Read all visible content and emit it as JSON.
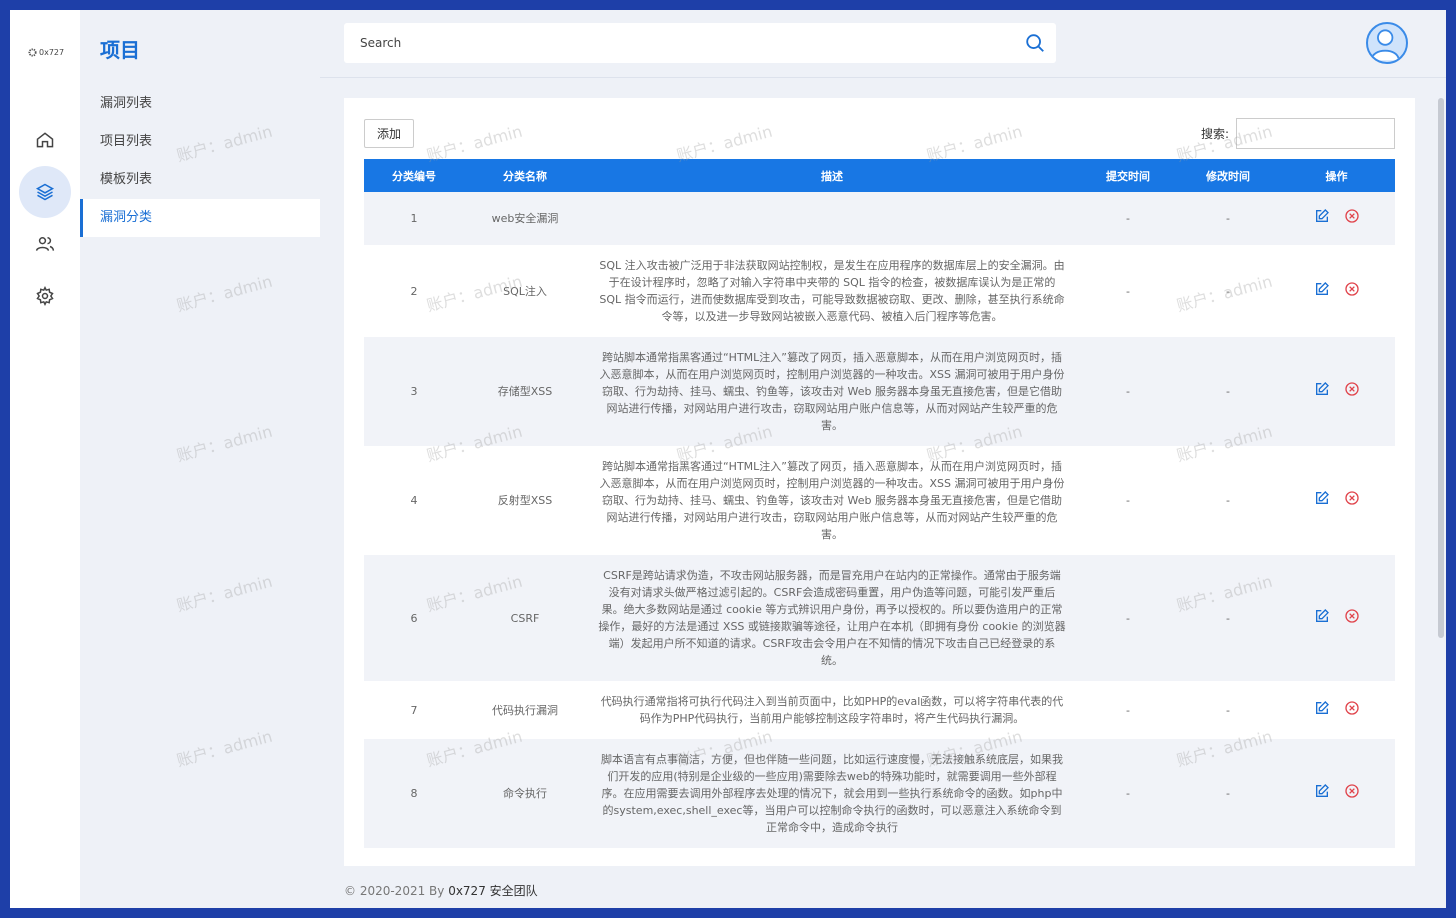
{
  "brand": {
    "logo_text": "0x727"
  },
  "nav_rail": {
    "items": [
      {
        "icon": "home-icon"
      },
      {
        "icon": "layers-icon",
        "active": true
      },
      {
        "icon": "users-icon"
      },
      {
        "icon": "gear-icon"
      }
    ]
  },
  "sidebar": {
    "title": "项目",
    "items": [
      {
        "label": "漏洞列表"
      },
      {
        "label": "项目列表"
      },
      {
        "label": "模板列表"
      },
      {
        "label": "漏洞分类",
        "active": true
      }
    ]
  },
  "search": {
    "placeholder": "Search"
  },
  "toolbar": {
    "add_label": "添加",
    "filter_label": "搜索:"
  },
  "watermark": "账户：admin",
  "table": {
    "headers": [
      "分类编号",
      "分类名称",
      "描述",
      "提交时间",
      "修改时间",
      "操作"
    ],
    "rows": [
      {
        "id": "1",
        "name": "web安全漏洞",
        "desc": "",
        "submitted": "-",
        "modified": "-"
      },
      {
        "id": "2",
        "name": "SQL注入",
        "desc": "SQL 注入攻击被广泛用于非法获取网站控制权，是发生在应用程序的数据库层上的安全漏洞。由于在设计程序时，忽略了对输入字符串中夹带的 SQL 指令的检查，被数据库误认为是正常的 SQL 指令而运行，进而使数据库受到攻击，可能导致数据被窃取、更改、删除，甚至执行系统命令等，以及进一步导致网站被嵌入恶意代码、被植入后门程序等危害。",
        "submitted": "-",
        "modified": "-"
      },
      {
        "id": "3",
        "name": "存储型XSS",
        "desc": "跨站脚本通常指黑客通过“HTML注入”篡改了网页，插入恶意脚本，从而在用户浏览网页时，插入恶意脚本，从而在用户浏览网页时，控制用户浏览器的一种攻击。XSS 漏洞可被用于用户身份窃取、行为劫持、挂马、蠕虫、钓鱼等，该攻击对 Web 服务器本身虽无直接危害，但是它借助网站进行传播，对网站用户进行攻击，窃取网站用户账户信息等，从而对网站产生较严重的危害。",
        "submitted": "-",
        "modified": "-"
      },
      {
        "id": "4",
        "name": "反射型XSS",
        "desc": "跨站脚本通常指黑客通过“HTML注入”篡改了网页，插入恶意脚本，从而在用户浏览网页时，插入恶意脚本，从而在用户浏览网页时，控制用户浏览器的一种攻击。XSS 漏洞可被用于用户身份窃取、行为劫持、挂马、蠕虫、钓鱼等，该攻击对 Web 服务器本身虽无直接危害，但是它借助网站进行传播，对网站用户进行攻击，窃取网站用户账户信息等，从而对网站产生较严重的危害。",
        "submitted": "-",
        "modified": "-"
      },
      {
        "id": "6",
        "name": "CSRF",
        "desc": "CSRF是跨站请求伪造，不攻击网站服务器，而是冒充用户在站内的正常操作。通常由于服务端没有对请求头做严格过滤引起的。CSRF会造成密码重置，用户伪造等问题，可能引发严重后果。绝大多数网站是通过 cookie 等方式辨识用户身份，再予以授权的。所以要伪造用户的正常操作，最好的方法是通过 XSS 或链接欺骗等途径，让用户在本机（即拥有身份 cookie 的浏览器端）发起用户所不知道的请求。CSRF攻击会令用户在不知情的情况下攻击自己已经登录的系统。",
        "submitted": "-",
        "modified": "-"
      },
      {
        "id": "7",
        "name": "代码执行漏洞",
        "desc": "代码执行通常指将可执行代码注入到当前页面中，比如PHP的eval函数，可以将字符串代表的代码作为PHP代码执行，当前用户能够控制这段字符串时，将产生代码执行漏洞。",
        "submitted": "-",
        "modified": "-"
      },
      {
        "id": "8",
        "name": "命令执行",
        "desc": "脚本语言有点事简洁，方便，但也伴随一些问题，比如运行速度慢，无法接触系统底层，如果我们开发的应用(特别是企业级的一些应用)需要除去web的特殊功能时，就需要调用一些外部程序。在应用需要去调用外部程序去处理的情况下，就会用到一些执行系统命令的函数。如php中的system,exec,shell_exec等，当用户可以控制命令执行的函数时，可以恶意注入系统命令到正常命令中，造成命令执行",
        "submitted": "-",
        "modified": "-"
      }
    ]
  },
  "footer": {
    "prefix": "© 2020-2021 By ",
    "team": "0x727 安全团队"
  },
  "colors": {
    "accent": "#1877e4",
    "frame": "#1e3fa8",
    "delete": "#e0434b"
  }
}
